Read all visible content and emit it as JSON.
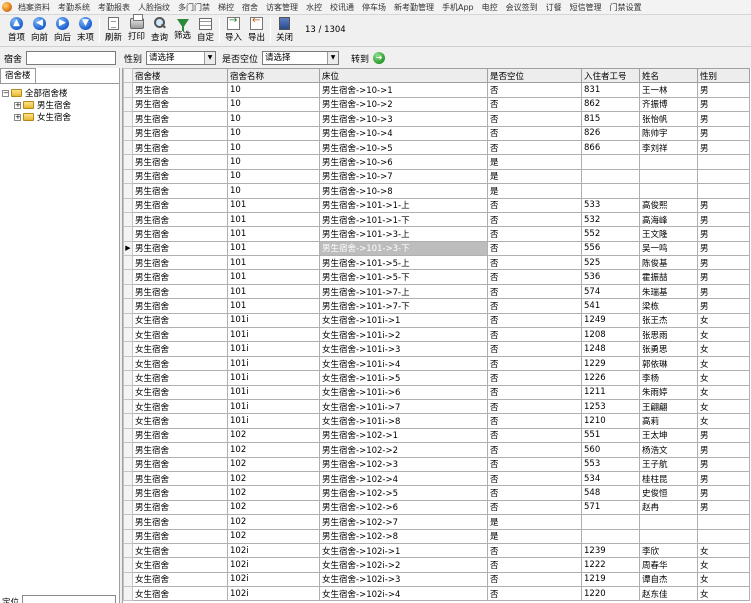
{
  "menu": [
    "档案资料",
    "考勤系统",
    "考勤报表",
    "人脸指纹",
    "多门门禁",
    "梯控",
    "宿舍",
    "访客管理",
    "水控",
    "校讯通",
    "停车场",
    "新考勤管理",
    "手机App",
    "电控",
    "会议签到",
    "订餐",
    "短信管理",
    "门禁设置"
  ],
  "toolbar": {
    "first": "首项",
    "prev": "向前",
    "next": "向后",
    "last": "末项",
    "refresh": "刷新",
    "print": "打印",
    "query": "查询",
    "filter": "筛选",
    "custom": "自定",
    "import": "导入",
    "export": "导出",
    "close": "关闭",
    "page_count": "13 / 1304"
  },
  "filter": {
    "dorm_label": "宿舍",
    "dorm_value": "",
    "gender_label": "性别",
    "gender_value": "请选择",
    "vacant_label": "是否空位",
    "vacant_value": "请选择",
    "goto_label": "转到"
  },
  "left_panel": {
    "tab_label": "宿舍楼",
    "tree": [
      {
        "label": "全部宿舍楼",
        "expander": "⊟",
        "level": 1
      },
      {
        "label": "男生宿舍",
        "expander": "⊞",
        "level": 2
      },
      {
        "label": "女生宿舍",
        "expander": "⊞",
        "level": 2
      }
    ],
    "bottom_label": "定位"
  },
  "grid": {
    "columns": [
      "宿舍楼",
      "宿舍名称",
      "床位",
      "是否空位",
      "入住者工号",
      "姓名",
      "性别"
    ],
    "current_row": 11,
    "rows": [
      [
        "男生宿舍",
        "10",
        "男生宿舍->10->1",
        "否",
        "831",
        "王一林",
        "男"
      ],
      [
        "男生宿舍",
        "10",
        "男生宿舍->10->2",
        "否",
        "862",
        "齐振博",
        "男"
      ],
      [
        "男生宿舍",
        "10",
        "男生宿舍->10->3",
        "否",
        "815",
        "张怡帆",
        "男"
      ],
      [
        "男生宿舍",
        "10",
        "男生宿舍->10->4",
        "否",
        "826",
        "陈帅宇",
        "男"
      ],
      [
        "男生宿舍",
        "10",
        "男生宿舍->10->5",
        "否",
        "866",
        "李刘祥",
        "男"
      ],
      [
        "男生宿舍",
        "10",
        "男生宿舍->10->6",
        "是",
        "",
        "",
        ""
      ],
      [
        "男生宿舍",
        "10",
        "男生宿舍->10->7",
        "是",
        "",
        "",
        ""
      ],
      [
        "男生宿舍",
        "10",
        "男生宿舍->10->8",
        "是",
        "",
        "",
        ""
      ],
      [
        "男生宿舍",
        "101",
        "男生宿舍->101->1-上",
        "否",
        "533",
        "高俊熙",
        "男"
      ],
      [
        "男生宿舍",
        "101",
        "男生宿舍->101->1-下",
        "否",
        "532",
        "高海峰",
        "男"
      ],
      [
        "男生宿舍",
        "101",
        "男生宿舍->101->3-上",
        "否",
        "552",
        "王文隆",
        "男"
      ],
      [
        "男生宿舍",
        "101",
        "男生宿舍->101->3-下",
        "否",
        "556",
        "吴一鸣",
        "男"
      ],
      [
        "男生宿舍",
        "101",
        "男生宿舍->101->5-上",
        "否",
        "525",
        "陈俊基",
        "男"
      ],
      [
        "男生宿舍",
        "101",
        "男生宿舍->101->5-下",
        "否",
        "536",
        "霍振喆",
        "男"
      ],
      [
        "男生宿舍",
        "101",
        "男生宿舍->101->7-上",
        "否",
        "574",
        "朱瑞基",
        "男"
      ],
      [
        "男生宿舍",
        "101",
        "男生宿舍->101->7-下",
        "否",
        "541",
        "梁栋",
        "男"
      ],
      [
        "女生宿舍",
        "101i",
        "女生宿舍->101i->1",
        "否",
        "1249",
        "张王杰",
        "女"
      ],
      [
        "女生宿舍",
        "101i",
        "女生宿舍->101i->2",
        "否",
        "1208",
        "张思雨",
        "女"
      ],
      [
        "女生宿舍",
        "101i",
        "女生宿舍->101i->3",
        "否",
        "1248",
        "张勇思",
        "女"
      ],
      [
        "女生宿舍",
        "101i",
        "女生宿舍->101i->4",
        "否",
        "1229",
        "郭依琳",
        "女"
      ],
      [
        "女生宿舍",
        "101i",
        "女生宿舍->101i->5",
        "否",
        "1226",
        "李杨",
        "女"
      ],
      [
        "女生宿舍",
        "101i",
        "女生宿舍->101i->6",
        "否",
        "1211",
        "朱雨婷",
        "女"
      ],
      [
        "女生宿舍",
        "101i",
        "女生宿舍->101i->7",
        "否",
        "1253",
        "王翩翩",
        "女"
      ],
      [
        "女生宿舍",
        "101i",
        "女生宿舍->101i->8",
        "否",
        "1210",
        "高莉",
        "女"
      ],
      [
        "男生宿舍",
        "102",
        "男生宿舍->102->1",
        "否",
        "551",
        "王太坤",
        "男"
      ],
      [
        "男生宿舍",
        "102",
        "男生宿舍->102->2",
        "否",
        "560",
        "杨浩文",
        "男"
      ],
      [
        "男生宿舍",
        "102",
        "男生宿舍->102->3",
        "否",
        "553",
        "王子航",
        "男"
      ],
      [
        "男生宿舍",
        "102",
        "男生宿舍->102->4",
        "否",
        "534",
        "桂柱昆",
        "男"
      ],
      [
        "男生宿舍",
        "102",
        "男生宿舍->102->5",
        "否",
        "548",
        "史俊恒",
        "男"
      ],
      [
        "男生宿舍",
        "102",
        "男生宿舍->102->6",
        "否",
        "571",
        "赵冉",
        "男"
      ],
      [
        "男生宿舍",
        "102",
        "男生宿舍->102->7",
        "是",
        "",
        "",
        ""
      ],
      [
        "男生宿舍",
        "102",
        "男生宿舍->102->8",
        "是",
        "",
        "",
        ""
      ],
      [
        "女生宿舍",
        "102i",
        "女生宿舍->102i->1",
        "否",
        "1239",
        "李欣",
        "女"
      ],
      [
        "女生宿舍",
        "102i",
        "女生宿舍->102i->2",
        "否",
        "1222",
        "周春华",
        "女"
      ],
      [
        "女生宿舍",
        "102i",
        "女生宿舍->102i->3",
        "否",
        "1219",
        "谭自杰",
        "女"
      ],
      [
        "女生宿舍",
        "102i",
        "女生宿舍->102i->4",
        "否",
        "1220",
        "赵东佳",
        "女"
      ]
    ]
  }
}
